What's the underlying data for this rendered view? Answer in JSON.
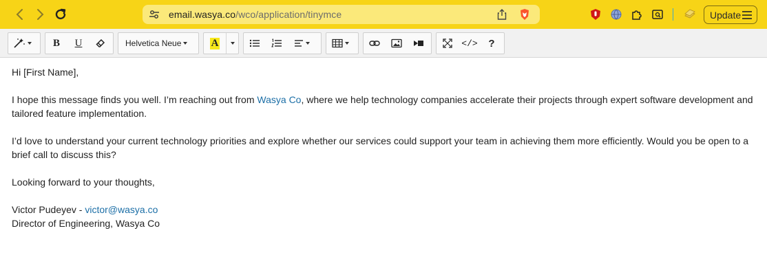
{
  "browser": {
    "url_host": "email.wasya.co",
    "url_path": "/wco/application/tinymce",
    "update_label": "Update",
    "colors": {
      "bar": "#f7d417",
      "urlbar": "#fbe97a"
    }
  },
  "toolbar": {
    "font_family": "Helvetica Neue",
    "buttons": [
      "magic-wand",
      "bold",
      "underline",
      "clear-format",
      "text-color",
      "bullet-list",
      "numbered-list",
      "align",
      "table",
      "link",
      "image",
      "media",
      "fullscreen",
      "source-code",
      "help"
    ],
    "bold_glyph": "B",
    "underline_glyph": "U",
    "text_color_glyph": "A",
    "code_glyph": "</>",
    "help_glyph": "?"
  },
  "email": {
    "greeting": "Hi [First Name],",
    "p1_before": "I hope this message finds you well. I’m reaching out from ",
    "p1_link": "Wasya Co",
    "p1_after": ", where we help technology companies accelerate their projects through expert software development and tailored feature implementation.",
    "p2": "I’d love to understand your current technology priorities and explore whether our services could support your team in achieving them more efficiently. Would you be open to a brief call to discuss this?",
    "p3": "Looking forward to your thoughts,",
    "sig_name": "Victor Pudeyev - ",
    "sig_email": "victor@wasya.co",
    "sig_title": "Director of Engineering, Wasya Co"
  }
}
